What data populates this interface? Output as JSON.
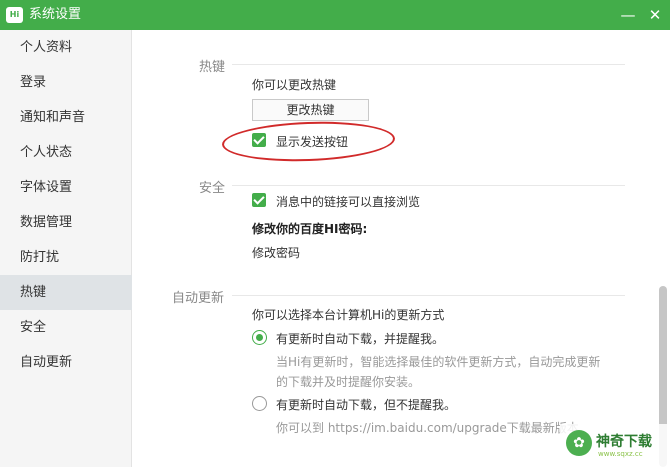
{
  "window": {
    "logo_text": "Hi",
    "title": "系统设置",
    "minimize_glyph": "—",
    "close_glyph": "✕"
  },
  "sidebar": {
    "items": [
      {
        "label": "个人资料"
      },
      {
        "label": "登录"
      },
      {
        "label": "通知和声音"
      },
      {
        "label": "个人状态"
      },
      {
        "label": "字体设置"
      },
      {
        "label": "数据管理"
      },
      {
        "label": "防打扰"
      },
      {
        "label": "热键",
        "active": true
      },
      {
        "label": "安全"
      },
      {
        "label": "自动更新"
      }
    ]
  },
  "hotkey": {
    "section_label": "热键",
    "description": "你可以更改热键",
    "change_button": "更改热键",
    "show_send_button_label": "显示发送按钮",
    "show_send_button_checked": true
  },
  "security": {
    "section_label": "安全",
    "link_browse_label": "消息中的链接可以直接浏览",
    "link_browse_checked": true,
    "password_heading": "修改你的百度HI密码:",
    "change_password_link": "修改密码"
  },
  "autoupdate": {
    "section_label": "自动更新",
    "description": "你可以选择本台计算机Hi的更新方式",
    "option1_label": "有更新时自动下载，并提醒我。",
    "option1_selected": true,
    "option1_desc_line1": "当Hi有更新时，智能选择最佳的软件更新方式，自动完成更新",
    "option1_desc_line2": "的下载并及时提醒你安装。",
    "option2_label": "有更新时自动下载，但不提醒我。",
    "option2_selected": false,
    "option2_desc": "你可以到 https://im.baidu.com/upgrade下载最新版本"
  },
  "watermark": {
    "text": "神奇下载",
    "sub": "www.sqxz.cc"
  },
  "colors": {
    "accent": "#43ad4a",
    "annotation": "#d12a2a"
  }
}
